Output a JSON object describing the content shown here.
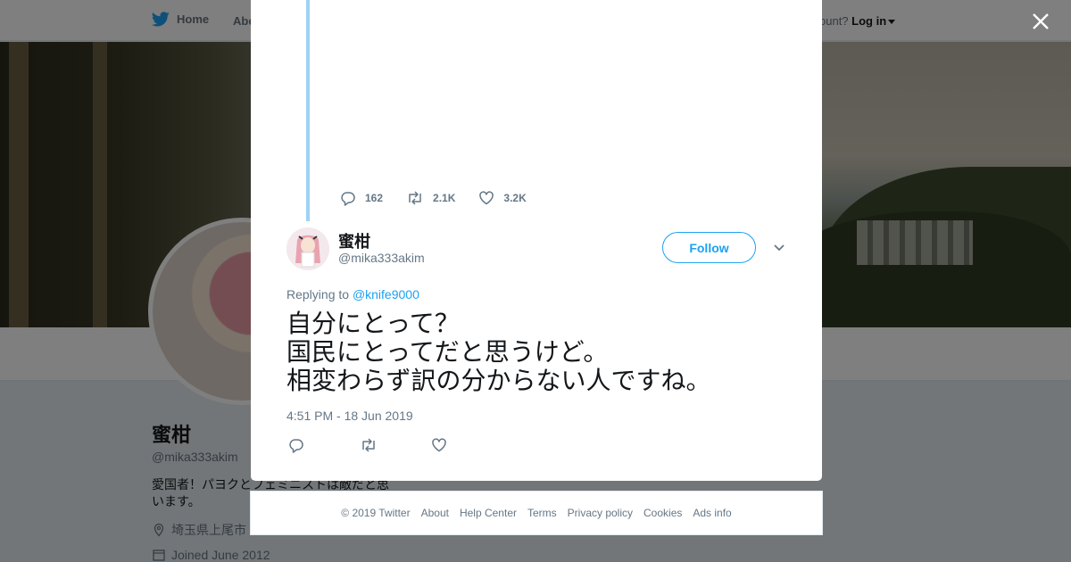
{
  "topbar": {
    "home_label": "Home",
    "about_label": "Abo",
    "account_prompt": "ccount?",
    "login_label": "Log in"
  },
  "profile": {
    "name": "蜜柑",
    "handle": "@mika333akim",
    "bio": "愛国者！パヨクとフェミニストは敵だと思います。",
    "location": "埼玉県上尾市",
    "joined": "Joined June 2012",
    "hidden_label": "Ads info"
  },
  "previous_tweet": {
    "replies": "162",
    "retweets": "2.1K",
    "likes": "3.2K"
  },
  "tweet": {
    "author_name": "蜜柑",
    "author_handle": "@mika333akim",
    "follow_label": "Follow",
    "replying_prefix": "Replying to",
    "replying_to": "@knife9000",
    "text_lines": [
      "自分にとって？",
      "国民にとってだと思うけど。",
      "相変わらず訳の分からない人ですね。"
    ],
    "timestamp": "4:51 PM - 18 Jun 2019"
  },
  "footer": {
    "links": [
      "© 2019 Twitter",
      "About",
      "Help Center",
      "Terms",
      "Privacy policy",
      "Cookies",
      "Ads info"
    ]
  },
  "icons": {
    "brand": "twitter-bird-icon",
    "close": "close-icon",
    "reply": "reply-icon",
    "retweet": "retweet-icon",
    "like": "heart-icon",
    "more": "chevron-down-icon",
    "location": "location-pin-icon",
    "calendar": "calendar-icon"
  },
  "colors": {
    "brand_blue": "#1da1f2",
    "thread_line": "#9fd3f5",
    "secondary_text": "#657786"
  }
}
